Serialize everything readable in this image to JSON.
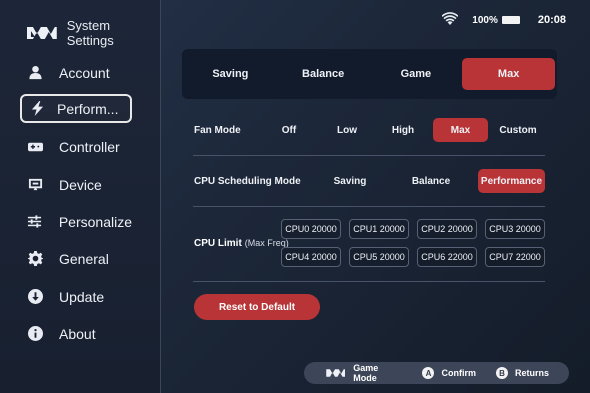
{
  "brand": {
    "title": "System Settings",
    "logo_icon": "brand-logo-icon"
  },
  "status": {
    "wifi_icon": "wifi-icon",
    "battery_percent": "100%",
    "time": "20:08"
  },
  "sidebar": {
    "items": [
      {
        "label": "Account",
        "icon": "person-icon",
        "active": false
      },
      {
        "label": "Perform...",
        "icon": "lightning-icon",
        "active": true
      },
      {
        "label": "Controller",
        "icon": "gamepad-icon",
        "active": false
      },
      {
        "label": "Device",
        "icon": "device-icon",
        "active": false
      },
      {
        "label": "Personalize",
        "icon": "sliders-icon",
        "active": false
      },
      {
        "label": "General",
        "icon": "gear-icon",
        "active": false
      },
      {
        "label": "Update",
        "icon": "download-circle-icon",
        "active": false
      },
      {
        "label": "About",
        "icon": "info-icon",
        "active": false
      }
    ]
  },
  "presets": {
    "options": [
      "Saving",
      "Balance",
      "Game",
      "Max"
    ],
    "selected": "Max"
  },
  "fan_mode": {
    "label": "Fan Mode",
    "options": [
      "Off",
      "Low",
      "High",
      "Max",
      "Custom"
    ],
    "selected": "Max"
  },
  "cpu_scheduling": {
    "label": "CPU Scheduling Mode",
    "options": [
      "Saving",
      "Balance",
      "Performance"
    ],
    "selected": "Performance"
  },
  "cpu_limit": {
    "label": "CPU Limit",
    "sublabel": "(Max Freq)",
    "cores": [
      "CPU0 20000",
      "CPU1 20000",
      "CPU2 20000",
      "CPU3 20000",
      "CPU4 20000",
      "CPU5 20000",
      "CPU6 22000",
      "CPU7 22000"
    ]
  },
  "reset": {
    "label": "Reset to Default"
  },
  "footer": {
    "game_mode": "Game Mode",
    "confirm_key": "A",
    "confirm": "Confirm",
    "returns_key": "B",
    "returns": "Returns"
  },
  "colors": {
    "accent": "#b93436",
    "panel": "#121b2b",
    "sidebar": "#1d2638"
  }
}
